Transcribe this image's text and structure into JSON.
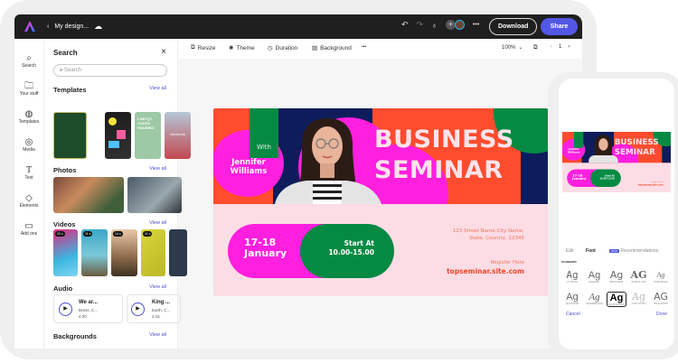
{
  "topbar": {
    "title": "My design...",
    "download": "Download",
    "share": "Share"
  },
  "rail": [
    {
      "icon": "search-icon",
      "label": "Search"
    },
    {
      "icon": "folder-icon",
      "label": "Your stuff"
    },
    {
      "icon": "templates-icon",
      "label": "Templates"
    },
    {
      "icon": "media-icon",
      "label": "Media"
    },
    {
      "icon": "text-icon",
      "label": "Text"
    },
    {
      "icon": "elements-icon",
      "label": "Elements"
    },
    {
      "icon": "addons-icon",
      "label": "Add ons"
    }
  ],
  "panel": {
    "title": "Search",
    "search_placeholder": "Search",
    "view_all": "View all",
    "sections": {
      "templates": "Templates",
      "photos": "Photos",
      "videos": "Videos",
      "audio": "Audio",
      "backgrounds": "Backgrounds"
    },
    "template_texts": [
      "LGBTQ+ YOUTH HOUSING",
      "Memorial"
    ],
    "videos": [
      "20 s",
      "11 s",
      "14 s",
      "11 s"
    ],
    "audio": [
      {
        "title": "We ar...",
        "artist": "Brass, C...",
        "duration": "4:20"
      },
      {
        "title": "King ...",
        "artist": "Earth, C...",
        "duration": "2:15"
      }
    ]
  },
  "toolbar": {
    "resize": "Resize",
    "theme": "Theme",
    "duration": "Duration",
    "background": "Background",
    "more": "•••",
    "zoom": "100%",
    "page": "1"
  },
  "design": {
    "with": "With",
    "name1": "Jennifer",
    "name2": "Williams",
    "title1": "BUSINESS",
    "title2": "SEMINAR",
    "date1": "17-18",
    "date2": "January",
    "start": "Start At",
    "time": "10.00-15.00",
    "addr1": "123 Street Name City Name,",
    "addr2": "State, Country, 12345",
    "register": "Register Here",
    "url": "topseminar.site.com"
  },
  "phone": {
    "tabs": [
      "Edit",
      "Font",
      "Recommendations"
    ],
    "new_badge": "NEW",
    "standard": "STANDARD",
    "fonts": [
      {
        "ag": "Ag",
        "name": "PT MONO"
      },
      {
        "ag": "Ag",
        "name": "RALEWAY"
      },
      {
        "ag": "Ag",
        "name": "BRINSTEND"
      },
      {
        "ag": "AG",
        "name": "STENCIL STD"
      },
      {
        "ag": "Ag",
        "name": "STORYBOOK"
      },
      {
        "ag": "Ag",
        "name": "QUICKSAND"
      },
      {
        "ag": "Ag",
        "name": "SEAWEED SCR"
      },
      {
        "ag": "Ag",
        "name": "SOURCE SANS"
      },
      {
        "ag": "Ag",
        "name": "STINT ULTRA"
      },
      {
        "ag": "AG",
        "name": "TRUE NORTH"
      }
    ],
    "cancel": "Cancel",
    "done": "Done"
  },
  "colors": {
    "accent": "#5258e4",
    "orange": "#ff4c2e",
    "magenta": "#ff1fde",
    "green": "#058a43",
    "navy": "#0e1c5c",
    "pink": "#fcdde5"
  }
}
